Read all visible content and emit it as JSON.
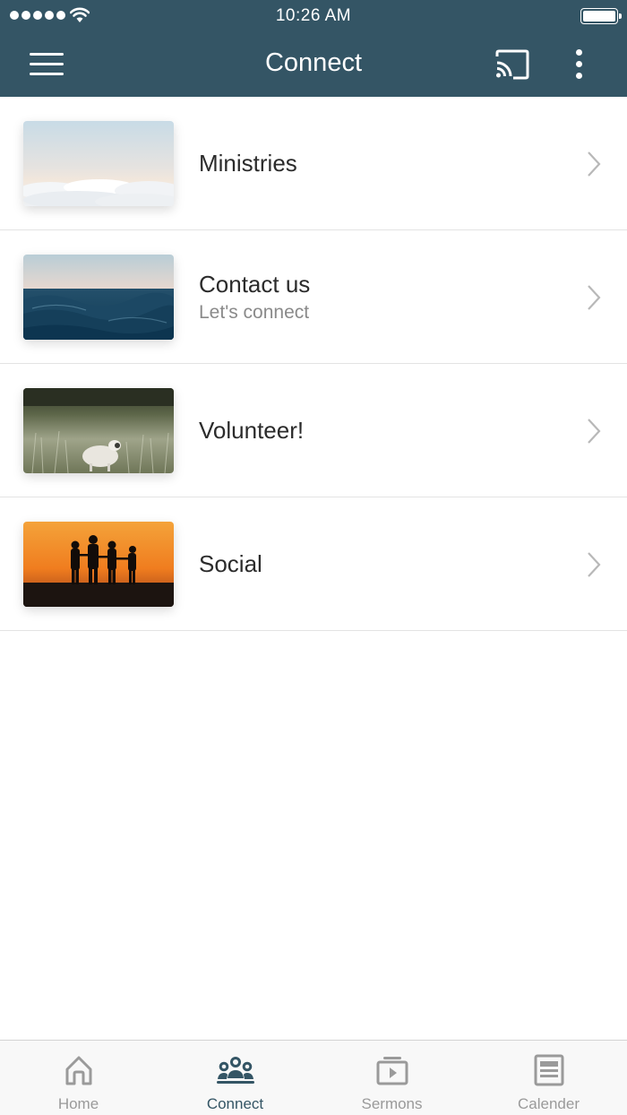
{
  "status_bar": {
    "time": "10:26 AM"
  },
  "header": {
    "title": "Connect"
  },
  "colors": {
    "header_bg": "#345565",
    "active_tab": "#345565",
    "inactive_tab": "#9a9a9a"
  },
  "icons": {
    "menu": "hamburger-menu-icon",
    "cast": "cast-icon",
    "more": "more-vertical-icon",
    "chevron": "chevron-right-icon"
  },
  "list": {
    "items": [
      {
        "title": "Ministries",
        "subtitle": "",
        "thumbnail": "sky-clouds-image"
      },
      {
        "title": "Contact us",
        "subtitle": "Let's connect",
        "thumbnail": "ocean-waves-image"
      },
      {
        "title": "Volunteer!",
        "subtitle": "",
        "thumbnail": "field-sheep-image"
      },
      {
        "title": "Social",
        "subtitle": "",
        "thumbnail": "sunset-silhouettes-image"
      }
    ]
  },
  "tabbar": {
    "tabs": [
      {
        "label": "Home",
        "icon": "home-icon",
        "active": false
      },
      {
        "label": "Connect",
        "icon": "people-icon",
        "active": true
      },
      {
        "label": "Sermons",
        "icon": "video-playlist-icon",
        "active": false
      },
      {
        "label": "Calender",
        "icon": "calendar-list-icon",
        "active": false
      }
    ]
  }
}
